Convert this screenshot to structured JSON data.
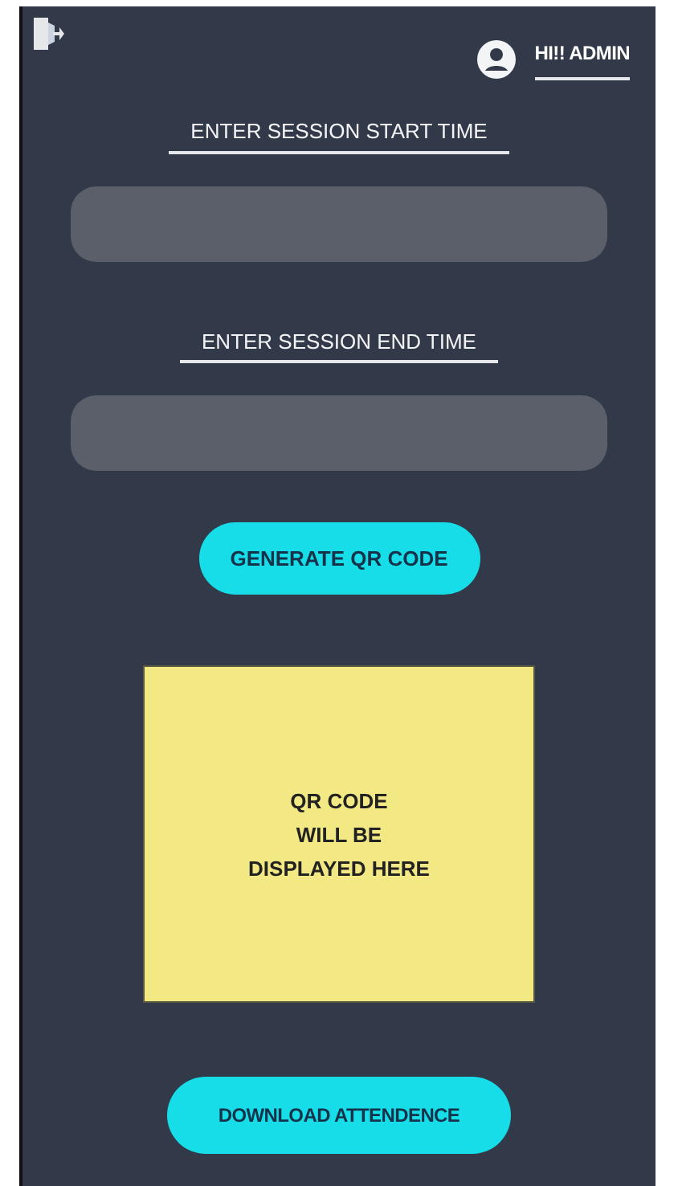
{
  "header": {
    "greeting": "HI!! ADMIN"
  },
  "fields": [
    {
      "label": "ENTER SESSION START TIME"
    },
    {
      "label": "ENTER SESSION END TIME"
    }
  ],
  "generate_button": "GENERATE QR CODE",
  "qr_placeholder": [
    "QR CODE",
    "WILL BE",
    "DISPLAYED HERE"
  ],
  "download_button": "DOWNLOAD ATTENDENCE"
}
